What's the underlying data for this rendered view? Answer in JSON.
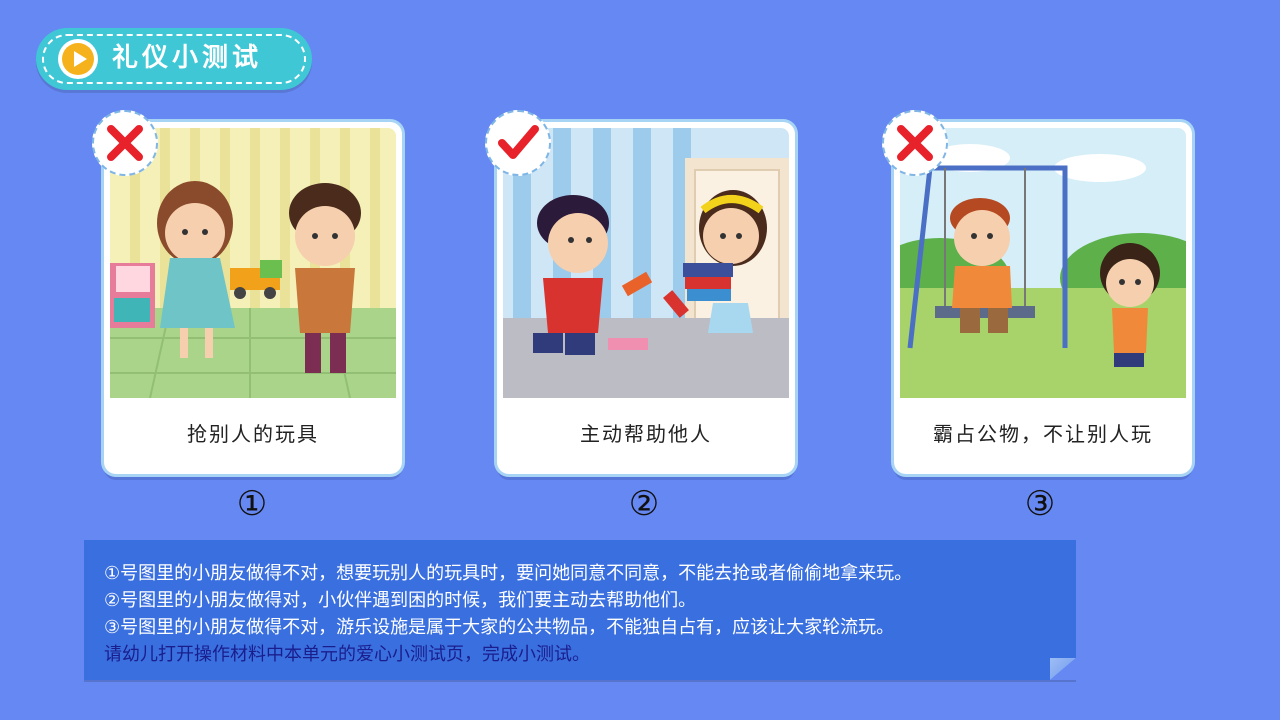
{
  "header": {
    "title": "礼仪小测试",
    "icon": "play-icon"
  },
  "cards": [
    {
      "caption": "抢别人的玩具",
      "verdict": "wrong",
      "number": "①"
    },
    {
      "caption": "主动帮助他人",
      "verdict": "right",
      "number": "②"
    },
    {
      "caption": "霸占公物，不让别人玩",
      "verdict": "wrong",
      "number": "③"
    }
  ],
  "explanation": {
    "lines": [
      "①号图里的小朋友做得不对，想要玩别人的玩具时，要问她同意不同意，不能去抢或者偷偷地拿来玩。",
      "②号图里的小朋友做得对，小伙伴遇到困的时候，我们要主动去帮助他们。",
      "③号图里的小朋友做得不对，游乐设施是属于大家的公共物品，不能独自占有，应该让大家轮流玩。"
    ],
    "instruction": "请幼儿打开操作材料中本单元的爱心小测试页，完成小测试。"
  },
  "colors": {
    "background": "#6688f2",
    "title_pill": "#3fc7d6",
    "wrong_mark": "#e8222a",
    "right_mark": "#e8222a",
    "explain_box": "#3a6fe0",
    "instruction_text": "#1a1e8c"
  }
}
